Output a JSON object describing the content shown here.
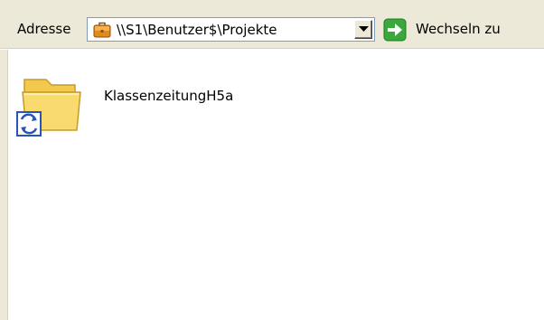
{
  "address_bar": {
    "label": "Adresse",
    "value": "\\\\S1\\Benutzer$\\Projekte",
    "location_icon": "briefcase-icon",
    "dropdown_icon": "chevron-down-icon",
    "go": {
      "label": "Wechseln zu",
      "icon": "green-arrow-right-icon"
    }
  },
  "content": {
    "items": [
      {
        "name": "KlassenzeitungH5a",
        "icon": "sync-folder-icon"
      }
    ]
  },
  "colors": {
    "chrome": "#ece9d8",
    "input_border": "#7f9db9",
    "go_green": "#3aa83a",
    "folder_yellow": "#f4d46a",
    "sync_blue": "#2a55b8"
  }
}
